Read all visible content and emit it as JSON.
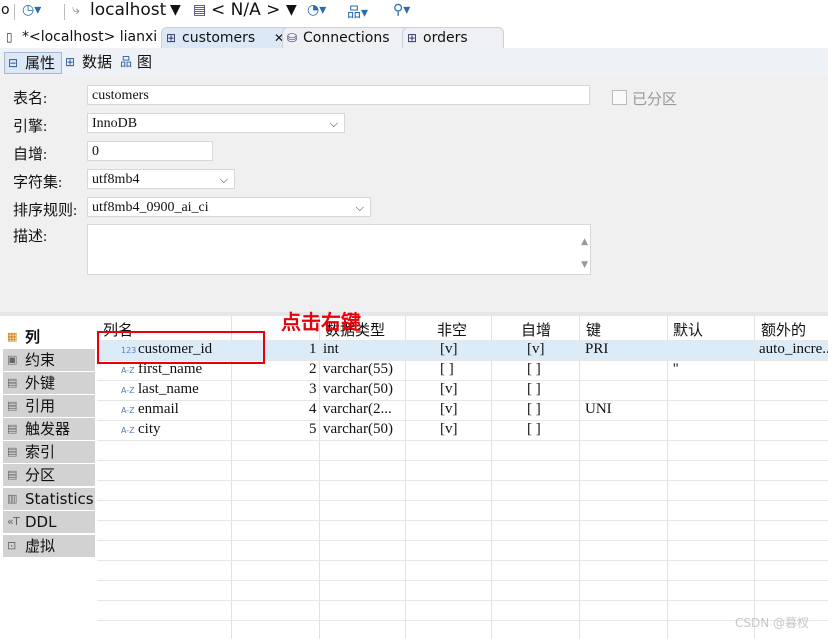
{
  "toolbar": {
    "partial_left": "o",
    "connection": "localhost",
    "database": "< N/A >"
  },
  "tabs": [
    {
      "label": "*<localhost> lianxi"
    },
    {
      "label": "customers",
      "close": "✕"
    },
    {
      "label": "Connections"
    },
    {
      "label": "orders"
    }
  ],
  "prop_tabs": {
    "properties": "属性",
    "data": "数据",
    "diagram": "图"
  },
  "props": {
    "table_name_label": "表名:",
    "table_name_value": "customers",
    "engine_label": "引擎:",
    "engine_value": "InnoDB",
    "auto_inc_label": "自增:",
    "auto_inc_value": "0",
    "charset_label": "字符集:",
    "charset_value": "utf8mb4",
    "collation_label": "排序规则:",
    "collation_value": "utf8mb4_0900_ai_ci",
    "desc_label": "描述:",
    "partitioned_label": "已分区"
  },
  "sidebar": {
    "items": [
      "列",
      "约束",
      "外键",
      "引用",
      "触发器",
      "索引",
      "分区",
      "Statistics",
      "DDL",
      "虚拟"
    ]
  },
  "columns_table": {
    "headers": [
      "列名",
      "数据类型",
      "非空",
      "自增",
      "键",
      "默认",
      "额外的"
    ],
    "rows": [
      {
        "type_icon": "123",
        "name": "customer_id",
        "num": "1",
        "dtype": "int",
        "notnull": "[v]",
        "autoinc": "[v]",
        "key": "PRI",
        "default": "",
        "extra": "auto_incre..."
      },
      {
        "type_icon": "A-Z",
        "name": "first_name",
        "num": "2",
        "dtype": "varchar(55)",
        "notnull": "[ ]",
        "autoinc": "[ ]",
        "key": "",
        "default": "''",
        "extra": ""
      },
      {
        "type_icon": "A-Z",
        "name": "last_name",
        "num": "3",
        "dtype": "varchar(50)",
        "notnull": "[v]",
        "autoinc": "[ ]",
        "key": "",
        "default": "",
        "extra": ""
      },
      {
        "type_icon": "A-Z",
        "name": "enmail",
        "num": "4",
        "dtype": "varchar(2...",
        "notnull": "[v]",
        "autoinc": "[ ]",
        "key": "UNI",
        "default": "",
        "extra": ""
      },
      {
        "type_icon": "A-Z",
        "name": "city",
        "num": "5",
        "dtype": "varchar(50)",
        "notnull": "[v]",
        "autoinc": "[ ]",
        "key": "",
        "default": "",
        "extra": ""
      }
    ]
  },
  "annotation": "点击右键",
  "watermark": "CSDN @暮杈",
  "colors": {
    "highlight_red": "#e8000b",
    "selected_row": "#dcebf8",
    "active_tab": "#dde8f6"
  }
}
